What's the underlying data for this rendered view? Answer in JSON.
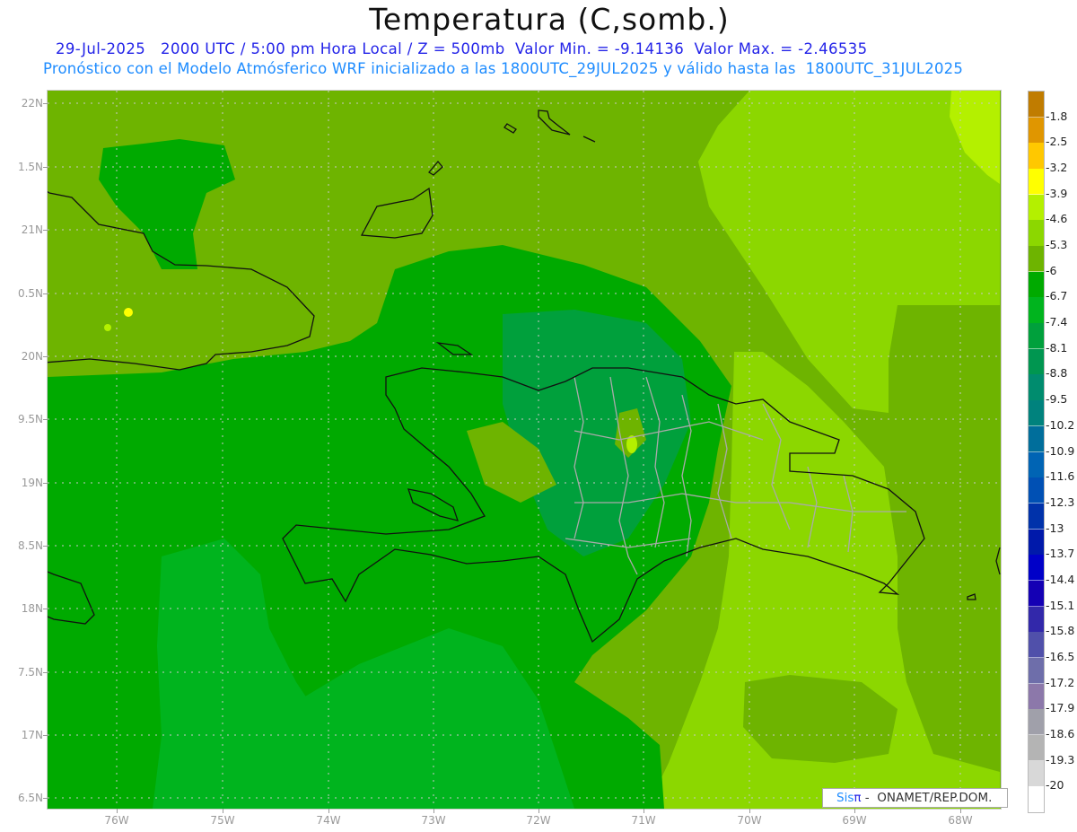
{
  "header": {
    "title": "Temperatura (C,somb.)",
    "line2": "29-Jul-2025   2000 UTC / 5:00 pm Hora Local / Z = 500mb  Valor Min. = -9.14136  Valor Max. = -2.46535",
    "line3": "Pronóstico con el Modelo Atmósferico WRF inicializado a las 1800UTC_29JUL2025 y válido hasta las  1800UTC_31JUL2025"
  },
  "map": {
    "lat_labels": [
      "22N",
      "1.5N",
      "21N",
      "0.5N",
      "20N",
      "9.5N",
      "19N",
      "8.5N",
      "18N",
      "7.5N",
      "17N",
      "6.5N"
    ],
    "lon_labels": [
      "76W",
      "75W",
      "74W",
      "73W",
      "72W",
      "71W",
      "70W",
      "69W",
      "68W"
    ],
    "field_colors": {
      "olive": "#6eb400",
      "green": "#00aa00",
      "green_light": "#00b41e",
      "green_sea": "#00a03c",
      "lime": "#8cd700",
      "yellowgreen": "#b4f000",
      "yellow": "#ffff00"
    }
  },
  "colorbar": {
    "labels": [
      "-1.8",
      "-2.5",
      "-3.2",
      "-3.9",
      "-4.6",
      "-5.3",
      "-6",
      "-6.7",
      "-7.4",
      "-8.1",
      "-8.8",
      "-9.5",
      "-10.2",
      "-10.9",
      "-11.6",
      "-12.3",
      "-13",
      "-13.7",
      "-14.4",
      "-15.1",
      "-15.8",
      "-16.5",
      "-17.2",
      "-17.9",
      "-18.6",
      "-19.3",
      "-20"
    ],
    "colors": [
      "#c07c00",
      "#e09600",
      "#ffc800",
      "#ffff00",
      "#b4f000",
      "#8cd700",
      "#6eb400",
      "#00aa00",
      "#00b41e",
      "#00a03c",
      "#009650",
      "#008c6e",
      "#00827d",
      "#006e9b",
      "#0064b4",
      "#0050b4",
      "#0032aa",
      "#0019aa",
      "#0000c8",
      "#1400b4",
      "#3228aa",
      "#5050aa",
      "#6e6eaa",
      "#8c78aa",
      "#a0a0aa",
      "#b4b4b4",
      "#d8d8d8",
      "#ffffff"
    ]
  },
  "credit": {
    "sis": "Sis",
    "pi": "π",
    "org": " -  ONAMET/REP.DOM."
  }
}
